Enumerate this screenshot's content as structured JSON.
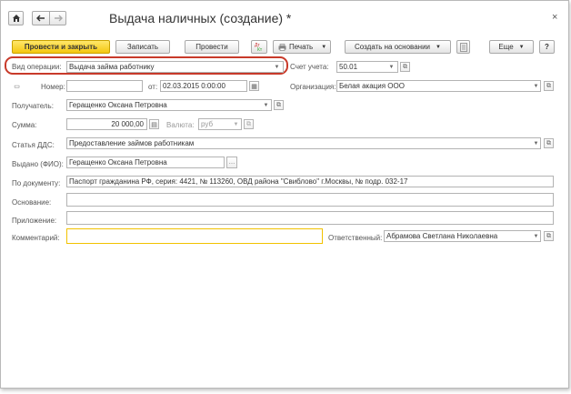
{
  "window": {
    "title": "Выдача наличных (создание) *",
    "home_icon": "home-icon",
    "back_icon": "arrow-left-icon",
    "forward_icon": "arrow-right-icon",
    "close_glyph": "×"
  },
  "toolbar": {
    "post_and_close": "Провести и закрыть",
    "save": "Записать",
    "post": "Провести",
    "print": "Печать",
    "create_based_on": "Создать на основании",
    "more": "Еще",
    "help": "?"
  },
  "form": {
    "operation_type_label": "Вид операции:",
    "operation_type_value": "Выдача займа работнику",
    "account_label": "Счет учета:",
    "account_value": "50.01",
    "number_label": "Номер:",
    "number_value": "",
    "date_label": "от:",
    "date_value": "02.03.2015  0:00:00",
    "organization_label": "Организация:",
    "organization_value": "Белая акация ООО",
    "recipient_label": "Получатель:",
    "recipient_value": "Геращенко Оксана Петровна",
    "amount_label": "Сумма:",
    "amount_value": "20 000,00",
    "currency_label": "Валюта:",
    "currency_value": "руб",
    "cash_flow_label": "Статья ДДС:",
    "cash_flow_value": "Предоставление займов работникам",
    "issued_to_label": "Выдано (ФИО):",
    "issued_to_value": "Геращенко Оксана Петровна",
    "by_document_label": "По документу:",
    "by_document_value": "Паспорт гражданина РФ, серия: 4421, № 113260, ОВД района \"Свиблово\" г.Москвы, № подр. 032-17",
    "basis_label": "Основание:",
    "basis_value": "",
    "attachment_label": "Приложение:",
    "attachment_value": "",
    "comment_label": "Комментарий:",
    "comment_value": "",
    "responsible_label": "Ответственный:",
    "responsible_value": "Абрамова Светлана Николаевна"
  }
}
